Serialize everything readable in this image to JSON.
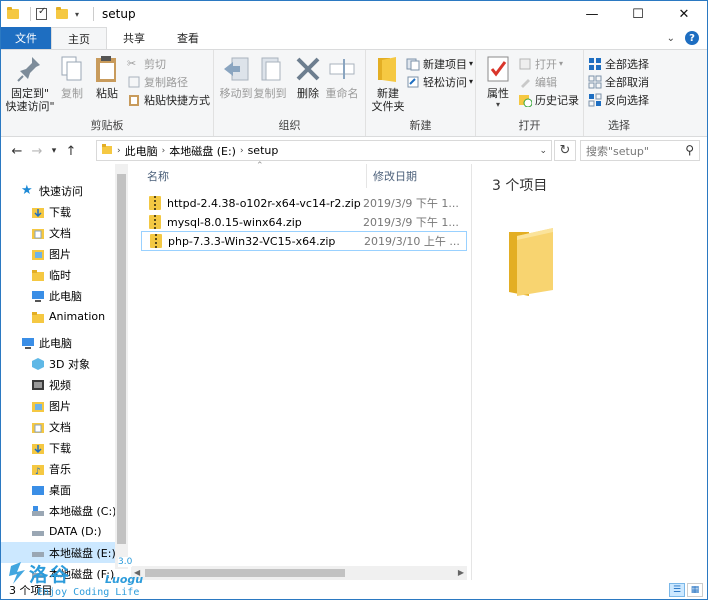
{
  "window": {
    "title": "setup",
    "controls": [
      "—",
      "☐",
      "✕"
    ]
  },
  "ribbon_tabs": [
    {
      "label": "文件",
      "kind": "file"
    },
    {
      "label": "主页",
      "kind": "active"
    },
    {
      "label": "共享",
      "kind": "normal"
    },
    {
      "label": "查看",
      "kind": "normal"
    }
  ],
  "ribbon": {
    "clipboard": {
      "label": "剪贴板",
      "pin": "固定到\"\n快速访问\"",
      "copy": "复制",
      "paste": "粘贴",
      "cut": "剪切",
      "copy_path": "复制路径",
      "paste_shortcut": "粘贴快捷方式"
    },
    "organize": {
      "label": "组织",
      "move_to": "移动到",
      "copy_to": "复制到",
      "delete": "删除",
      "rename": "重命名"
    },
    "new": {
      "label": "新建",
      "new_folder": "新建\n文件夹",
      "new_item": "新建项目",
      "easy_access": "轻松访问"
    },
    "open": {
      "label": "打开",
      "properties": "属性",
      "open": "打开",
      "edit": "编辑",
      "history": "历史记录"
    },
    "select": {
      "label": "选择",
      "select_all": "全部选择",
      "select_none": "全部取消",
      "invert": "反向选择"
    }
  },
  "address": {
    "crumbs": [
      "此电脑",
      "本地磁盘 (E:)",
      "setup"
    ],
    "search_placeholder": "搜索\"setup\""
  },
  "nav_pane": {
    "quick_access": {
      "label": "快速访问",
      "items": [
        "下载",
        "文档",
        "图片",
        "临时",
        "此电脑",
        "Animation"
      ]
    },
    "this_pc": {
      "label": "此电脑",
      "items": [
        "3D 对象",
        "视频",
        "图片",
        "文档",
        "下载",
        "音乐",
        "桌面",
        "本地磁盘 (C:)",
        "DATA (D:)",
        "本地磁盘 (E:)",
        "本地磁盘 (F:)"
      ]
    }
  },
  "file_list": {
    "columns": {
      "name": "名称",
      "modified": "修改日期"
    },
    "rows": [
      {
        "name": "httpd-2.4.38-o102r-x64-vc14-r2.zip",
        "modified": "2019/3/9 下午 1...",
        "selected": false
      },
      {
        "name": "mysql-8.0.15-winx64.zip",
        "modified": "2019/3/9 下午 1...",
        "selected": false
      },
      {
        "name": "php-7.3.3-Win32-VC15-x64.zip",
        "modified": "2019/3/10 上午 ...",
        "selected": true
      }
    ]
  },
  "preview": {
    "count": "3 个项目"
  },
  "status": {
    "text": "3 个项目"
  },
  "watermark": {
    "brand": "洛谷",
    "latin": "Luogu",
    "slogan": "Enjoy Coding Life",
    "version": "3.0"
  },
  "colors": {
    "accent": "#1e6ec1",
    "folder": "#f5c842",
    "selection": "#cce8ff"
  }
}
